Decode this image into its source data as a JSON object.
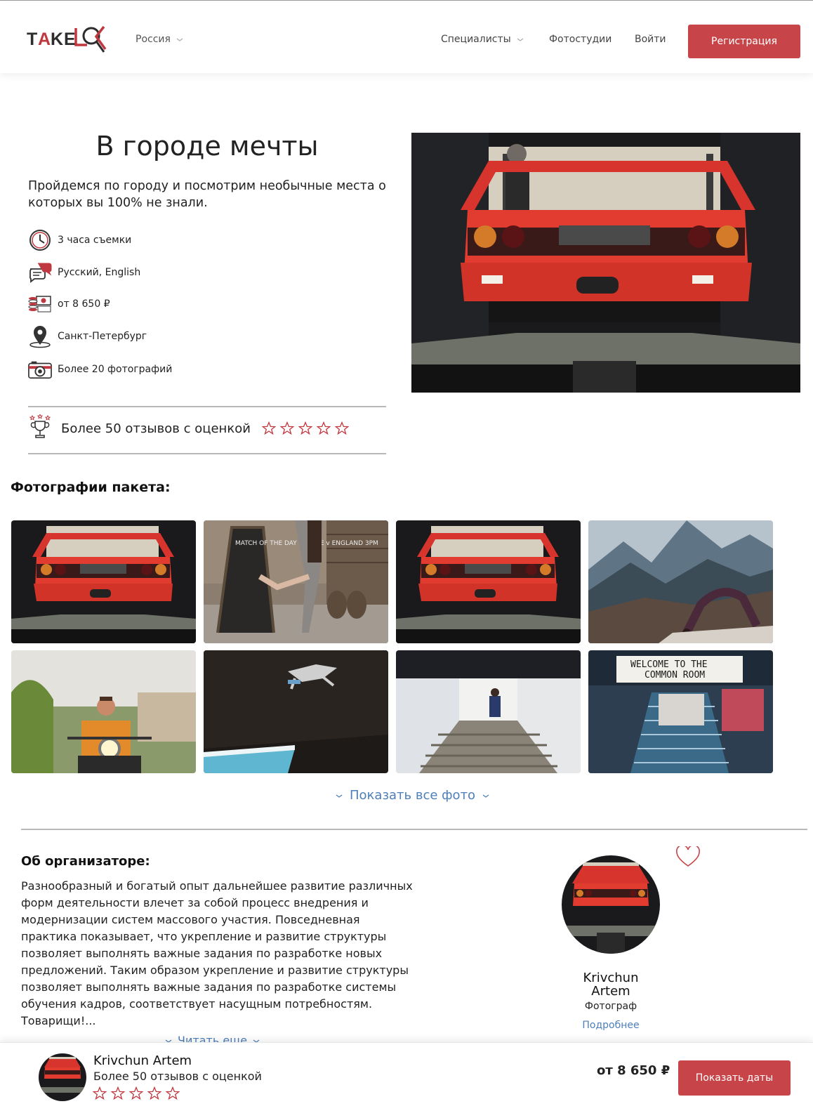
{
  "header": {
    "logo_text": "TAKELOOK",
    "region": "Россия",
    "nav_specialists": "Специалисты",
    "nav_studios": "Фотостудии",
    "nav_login": "Войти",
    "register_label": "Регистрация"
  },
  "hero": {
    "title": "В городе мечты",
    "subtitle": "Пройдемся по городу и посмотрим необычные места о которых вы 100% не знали.",
    "features": [
      {
        "icon": "clock-icon",
        "text": "3 часа съемки"
      },
      {
        "icon": "chat-bubbles-icon",
        "text": "Русский, English"
      },
      {
        "icon": "money-icon",
        "text": "от 8 650 ₽"
      },
      {
        "icon": "map-pin-icon",
        "text": "Санкт-Петербург"
      },
      {
        "icon": "camera-icon",
        "text": "Более 20 фотографий"
      }
    ],
    "rating_text": "Более 50 отзывов с оценкой",
    "rating_stars": 5
  },
  "gallery": {
    "title": "Фотографии пакета:",
    "photos": [
      "red-car-rear",
      "woman-chalkboard-sign",
      "red-car-rear",
      "woman-yoga-mountains",
      "man-motorcycle",
      "skateboard-jump",
      "man-stairs-tunnel",
      "common-room-stairs"
    ],
    "photo_signs": {
      "chalkboard": "MATCH OF THE DAY FRANCE v ENGLAND 3PM",
      "marquee_line1": "WELCOME TO THE",
      "marquee_line2": "COMMON ROOM"
    },
    "show_all_label": "Показать все фото"
  },
  "about": {
    "title": "Об организаторе:",
    "text": "Разнообразный и богатый опыт дальнейшее развитие различных форм деятельности влечет за собой процесс внедрения и модернизации систем массового участия. Повседневная практика показывает, что укрепление и развитие структуры позволяет выполнять важные задания по разработке новых предложений. Таким образом укрепление и развитие структуры позволяет выполнять важные задания по разработке системы обучения кадров, соответствует насущным потребностям. Товарищи!...",
    "read_more": "Читать еще",
    "organizer_name": "Krivchun Artem",
    "organizer_role": "Фотограф",
    "organizer_more": "Подробнее"
  },
  "bottombar": {
    "name": "Krivchun Artem",
    "reviews": "Более 50 отзывов с оценкой",
    "stars": 5,
    "price": "от 8 650 ₽",
    "button": "Показать даты"
  },
  "colors": {
    "accent": "#c74548",
    "link": "#4d7fb8",
    "text": "#222222"
  }
}
